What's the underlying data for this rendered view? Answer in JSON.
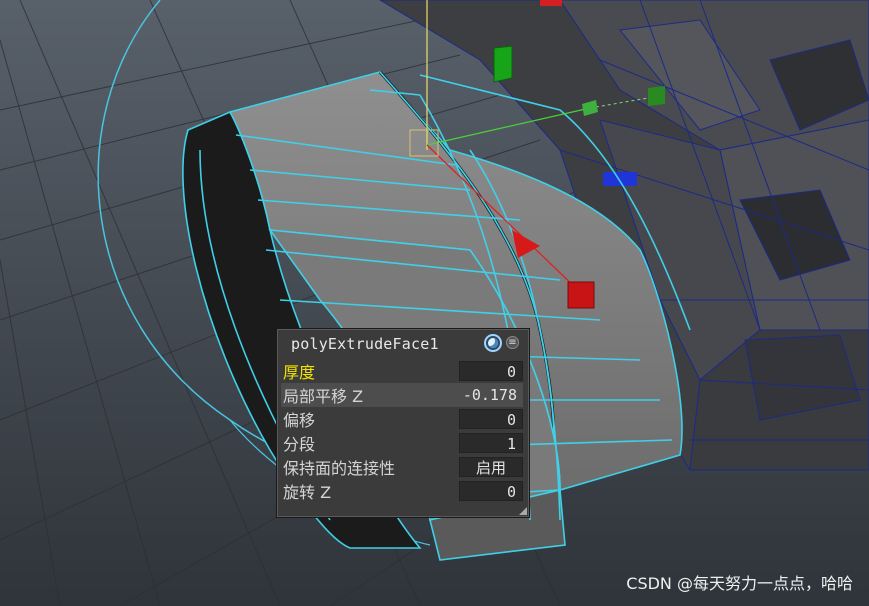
{
  "node_editor": {
    "title": "polyExtrudeFace1",
    "rows": [
      {
        "label": "厚度",
        "value": "0",
        "selected": true
      },
      {
        "label": "局部平移 Z",
        "value": "-0.178"
      },
      {
        "label": "偏移",
        "value": "0"
      },
      {
        "label": "分段",
        "value": "1"
      },
      {
        "label": "保持面的连接性",
        "value": "启用"
      },
      {
        "label": "旋转 Z",
        "value": "0"
      }
    ]
  },
  "watermark": "CSDN @每天努力一点点，哈哈",
  "colors": {
    "selected_label": "#f2e300",
    "wireframe_selection": "#3fd0e8",
    "background": "#3f454c"
  },
  "icons": [
    "globe-icon",
    "menu-icon",
    "resize-grip-icon"
  ]
}
